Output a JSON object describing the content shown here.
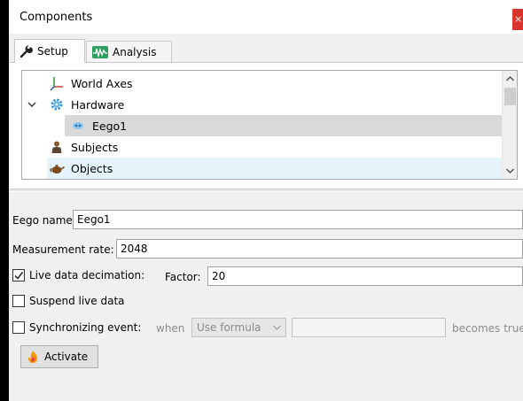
{
  "window": {
    "title": "Components",
    "close_glyph": "×"
  },
  "tabs": [
    {
      "label": "Setup",
      "icon": "wrench-icon",
      "active": true
    },
    {
      "label": "Analysis",
      "icon": "waveform-icon",
      "active": false
    }
  ],
  "tree": {
    "items": [
      {
        "label": "World Axes",
        "icon": "axes-icon",
        "indent": 1
      },
      {
        "label": "Hardware",
        "icon": "gear-icon",
        "indent": 0,
        "expanded": true
      },
      {
        "label": "Eego1",
        "icon": "device-icon",
        "indent": 2,
        "selected": true
      },
      {
        "label": "Subjects",
        "icon": "person-icon",
        "indent": 1
      },
      {
        "label": "Objects",
        "icon": "teapot-icon",
        "indent": 1,
        "hover": true
      }
    ]
  },
  "form": {
    "eego_name_label": "Eego name:",
    "eego_name_value": "Eego1",
    "measurement_rate_label": "Measurement rate:",
    "measurement_rate_value": "2048",
    "live_decimation_label": "Live data decimation:",
    "live_decimation_checked": true,
    "factor_label": "Factor:",
    "factor_value": "20",
    "suspend_label": "Suspend live data",
    "suspend_checked": false,
    "sync_label": "Synchronizing event:",
    "sync_checked": false,
    "when_label": "when",
    "when_option": "Use formula",
    "becomes_true_label": "becomes true",
    "activate_label": "Activate"
  }
}
